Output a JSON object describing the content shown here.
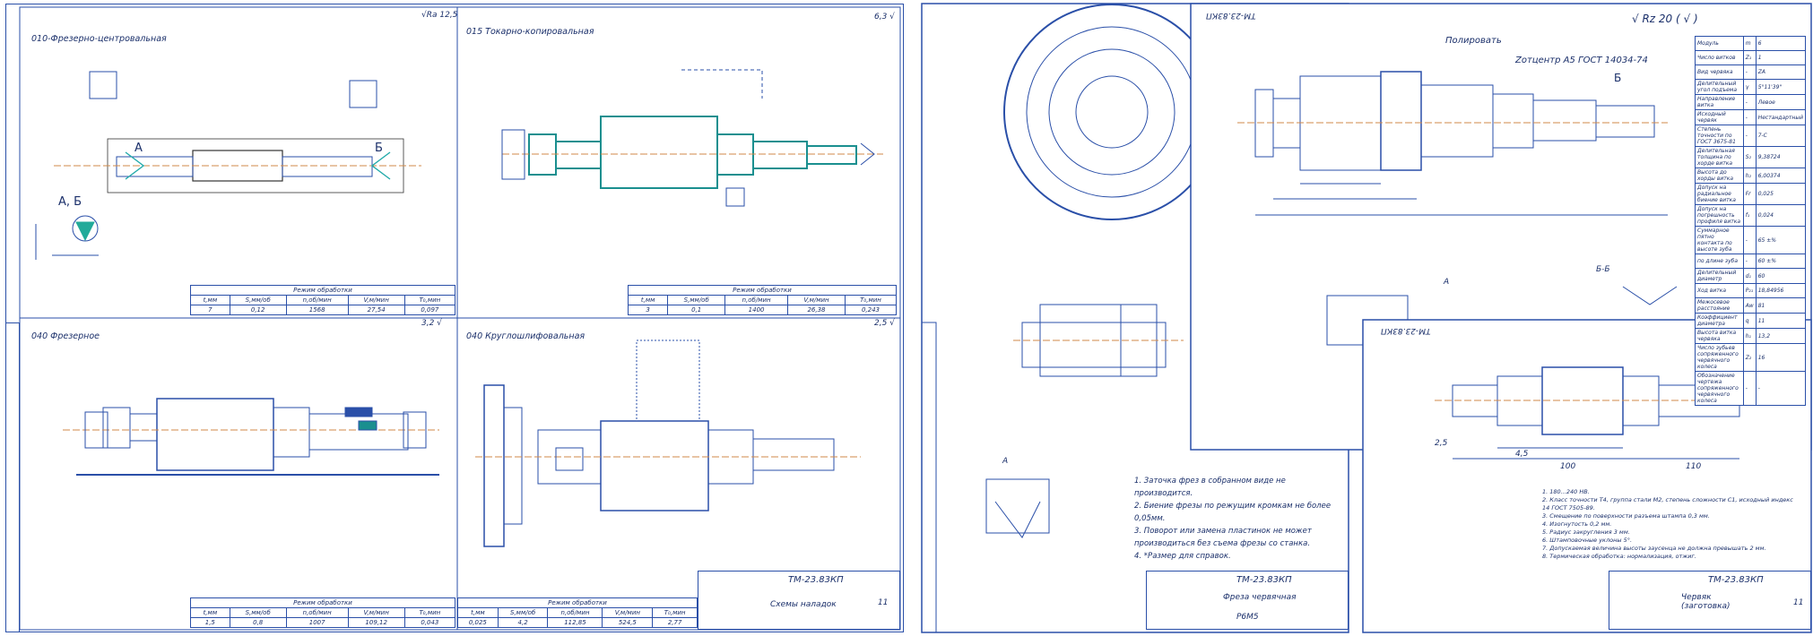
{
  "left_sheet": {
    "ops": [
      {
        "title": "010-Фрезерно-центровальная",
        "roughness": "√Ra 12,5"
      },
      {
        "title": "015 Токарно-копировальная",
        "roughness": "6,3 √"
      },
      {
        "title": "040 Фрезерное",
        "roughness": "3,2 √"
      },
      {
        "title": "040 Круглошлифовальная",
        "roughness": "2,5 √"
      }
    ],
    "mode_title": "Режим обработки",
    "mode_headers": [
      "t,мм",
      "S,мм/об",
      "n,об/мин",
      "V,м/мин",
      "T₀,мин"
    ],
    "modes": [
      [
        "7",
        "0,12",
        "1568",
        "27,54",
        "0,097"
      ],
      [
        "3",
        "0,1",
        "1400",
        "26,38",
        "0,243"
      ],
      [
        "1,5",
        "0,8",
        "1007",
        "109,12",
        "0,043"
      ],
      [
        "0,025",
        "4,2",
        "112,85",
        "524,5",
        "2,77"
      ]
    ],
    "labels": {
      "a": "А",
      "b": "Б",
      "ab": "А, Б",
      "ab_left": "А, Б"
    },
    "stamp_code": "ТМ-23.83КП",
    "stamp_name": "Схемы наладок",
    "stamp_sheet": "11"
  },
  "middle_sheet": {
    "notes": [
      "1. Заточка фрез в собранном виде не производится.",
      "2. Биение фрезы по режущим кромкам не более 0,05мм.",
      "3. Поворот или замена пластинок не может производиться без съема фрезы со станка.",
      "4. *Размер для справок."
    ],
    "view_label": "А",
    "stamp_code": "ТМ-23.83КП",
    "stamp_name": "Фреза червячная",
    "stamp_material": "Р6М5"
  },
  "right_sheet": {
    "corner_code": "ТМ-23.83КП",
    "roughness": "√ Rz 20 ( √ )",
    "callouts": [
      "Полировать",
      "Zотцентр А5 ГОСТ 14034-74",
      "Б",
      "Б-Б",
      "А"
    ],
    "params": [
      [
        "Модуль",
        "m",
        "6"
      ],
      [
        "Число витков",
        "Z₁",
        "1"
      ],
      [
        "Вид червяка",
        "-",
        "ZA"
      ],
      [
        "Делительный угол подъема",
        "γ",
        "5°11'39\""
      ],
      [
        "Направление витка",
        "-",
        "Левое"
      ],
      [
        "Исходный червяк",
        "-",
        "Нестандартный"
      ],
      [
        "Степень точности по ГОСТ 3675-81",
        "-",
        "7-С"
      ],
      [
        "Делительная толщина по хорде витка",
        "S₂",
        "9,38724"
      ],
      [
        "Высота до хорды витка",
        "h₂",
        "6,00374"
      ],
      [
        "Допуск на радиальное биение витка",
        "Fr",
        "0,025"
      ],
      [
        "Допуск на погрешность профиля витка",
        "f₁",
        "0,024"
      ],
      [
        "Суммарное пятно контакта по высоте зуба",
        "-",
        "65 ±%"
      ],
      [
        "по длине зуба",
        "-",
        "60 ±%"
      ],
      [
        "Делительный диаметр",
        "d₁",
        "60"
      ],
      [
        "Ход витка",
        "P₂₁",
        "18,84956"
      ],
      [
        "Межосевое расстояние",
        "Aw",
        "81"
      ],
      [
        "Коэффициент диаметра",
        "q",
        "11"
      ],
      [
        "Высота витка червяка",
        "h₁",
        "13,2"
      ],
      [
        "Число зубьев сопряженного червячного колеса",
        "Z₂",
        "16"
      ],
      [
        "Обозначение чертежа сопряженного червячного колеса",
        "-",
        "-"
      ]
    ]
  },
  "blank_sheet": {
    "corner_code": "ТМ-23.83КП",
    "notes": [
      "1. 180...240 НВ.",
      "2. Класс точности Т4, группа стали М2, степень сложности С1, исходный индекс 14 ГОСТ 7505-89.",
      "3. Смещение по поверхности разъема штампа 0,3 мм.",
      "4. Изогнутость 0,2 мм.",
      "5. Радиус закругления 3 мм.",
      "6. Штамповочные уклоны 5°.",
      "7. Допускаемая величина высоты заусенца не должна превышать 2 мм.",
      "8. Термическая обработка: нормализация, отжиг."
    ],
    "dims": [
      "100",
      "110",
      "4,5",
      "2,5"
    ],
    "stamp_code": "ТМ-23.83КП",
    "stamp_name": "Червяк (заготовка)",
    "stamp_sheet": "11"
  }
}
